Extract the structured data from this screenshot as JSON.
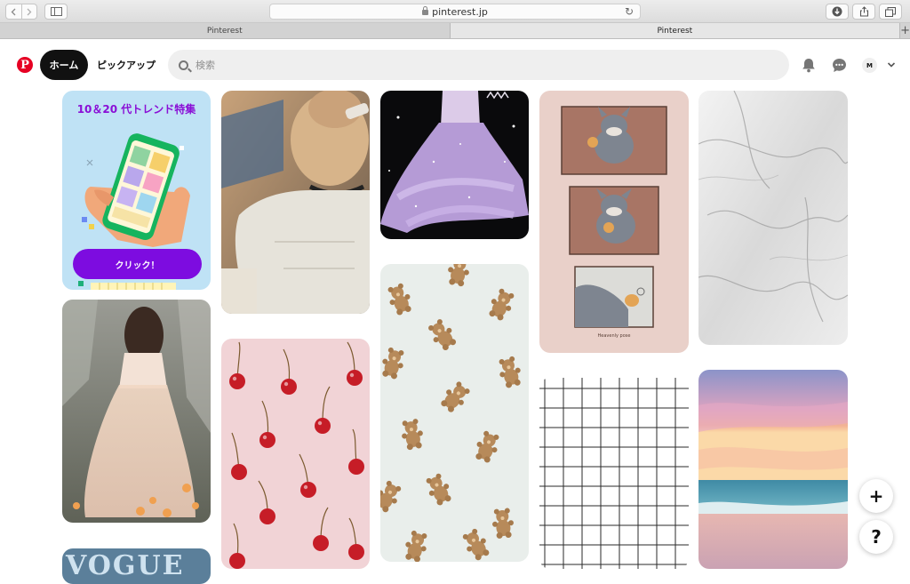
{
  "browser": {
    "url": "pinterest.jp",
    "tabs": [
      {
        "label": "Pinterest",
        "active": false
      },
      {
        "label": "Pinterest",
        "active": true
      }
    ],
    "new_tab_label": "+"
  },
  "header": {
    "logo": "P",
    "home_label": "ホーム",
    "pickup_label": "ピックアップ",
    "search_placeholder": "検索",
    "avatar_initial": "M",
    "brand_color": "#e60023"
  },
  "promo": {
    "title": "10＆20 代トレンド特集",
    "button_label": "クリック！",
    "accent": "#7d0ce0"
  },
  "pins": {
    "vogue_text": "VOGUE",
    "tom_caption": "Heavenly pose"
  },
  "fabs": {
    "add_label": "+",
    "help_label": "?"
  }
}
